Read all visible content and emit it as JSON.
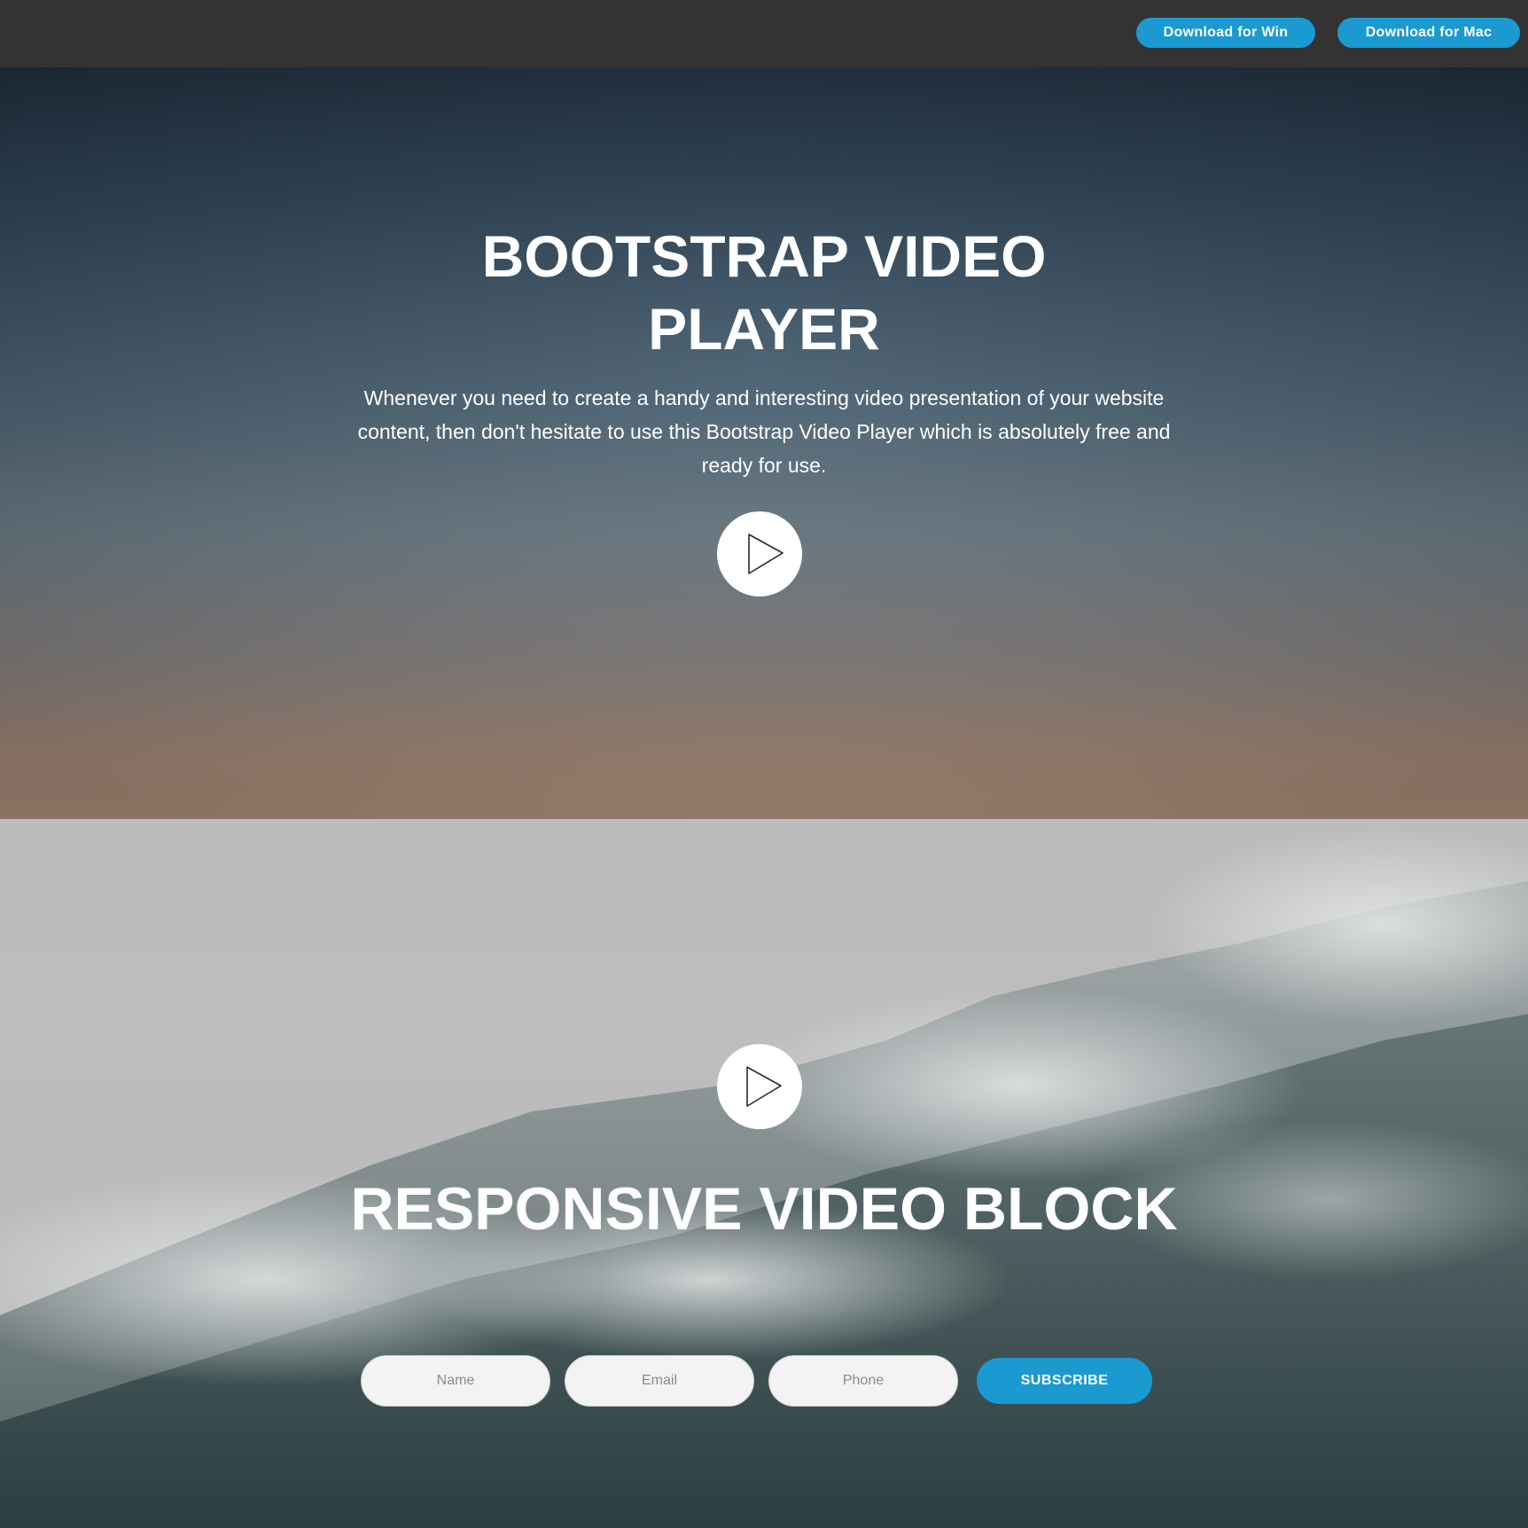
{
  "topbar": {
    "download_win": "Download for Win",
    "download_mac": "Download for Mac"
  },
  "hero": {
    "title": "BOOTSTRAP VIDEO PLAYER",
    "description": "Whenever you need to create a handy and interesting video presentation of your website content, then don't hesitate to use this Bootstrap Video Player which is absolutely free and ready for use.",
    "play_icon": "play-icon"
  },
  "video_block": {
    "title": "RESPONSIVE VIDEO BLOCK",
    "play_icon": "play-icon",
    "form": {
      "name_placeholder": "Name",
      "email_placeholder": "Email",
      "phone_placeholder": "Phone",
      "subscribe_label": "SUBSCRIBE"
    }
  },
  "colors": {
    "topbar_bg": "#333333",
    "accent": "#1b9ad2",
    "text_on_dark": "#ffffff"
  }
}
